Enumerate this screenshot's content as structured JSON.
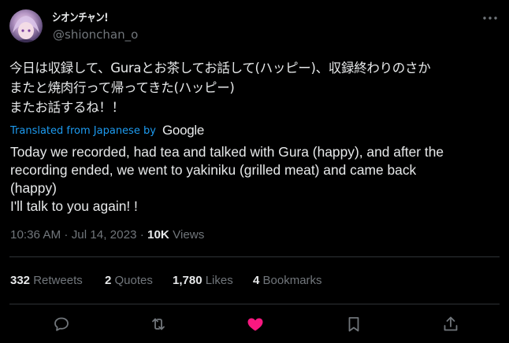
{
  "author": {
    "display_name": "シオンチャン!",
    "handle": "@shionchan_o"
  },
  "tweet": {
    "original_text": "今日は収録して、Guraとお茶してお話して(ハッピー)、収録終わりのさか\nまたと焼肉行って帰ってきた(ハッピー)\nまたお話するね！！",
    "translated_label": "Translated from Japanese by",
    "translator_logo": "Google",
    "translation": "Today we recorded, had tea and talked with Gura (happy), and after the\nrecording ended, we went to yakiniku (grilled meat) and came back\n(happy)\nI'll talk to you again! !",
    "time": "10:36 AM",
    "separator": "·",
    "date": "Jul 14, 2023",
    "views_count": "10K",
    "views_label": "Views"
  },
  "stats": {
    "retweets": {
      "count": "332",
      "label": "Retweets"
    },
    "quotes": {
      "count": "2",
      "label": "Quotes"
    },
    "likes": {
      "count": "1,780",
      "label": "Likes"
    },
    "bookmarks": {
      "count": "4",
      "label": "Bookmarks"
    }
  },
  "actions": {
    "reply_icon": "reply-icon",
    "retweet_icon": "retweet-icon",
    "like_icon": "heart-icon",
    "bookmark_icon": "bookmark-icon",
    "share_icon": "share-icon"
  },
  "colors": {
    "background": "#000000",
    "text": "#e7e9ea",
    "secondary": "#71767b",
    "link": "#1d9bf0",
    "like": "#f91880",
    "divider": "#2f3336"
  }
}
